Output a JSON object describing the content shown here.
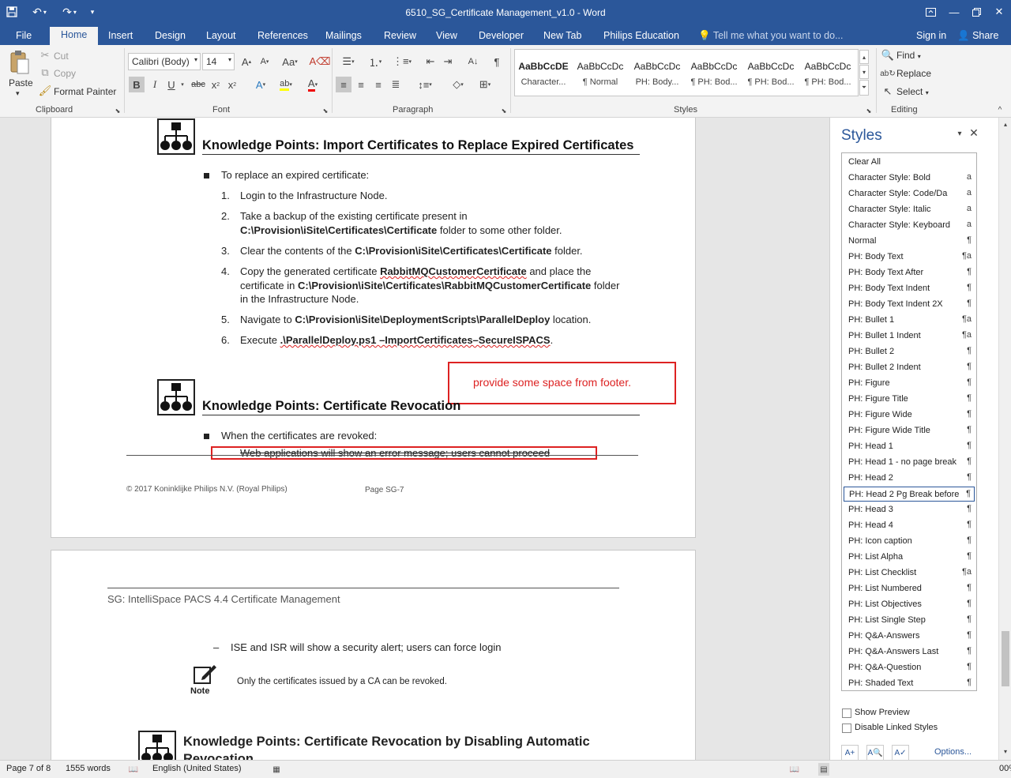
{
  "window": {
    "title": "6510_SG_Certificate Management_v1.0 - Word"
  },
  "quick_access": {
    "save_icon": "save-icon",
    "undo_icon": "undo-icon",
    "redo_icon": "redo-icon"
  },
  "tabs": [
    "File",
    "Home",
    "Insert",
    "Design",
    "Layout",
    "References",
    "Mailings",
    "Review",
    "View",
    "Developer",
    "New Tab",
    "Philips Education"
  ],
  "tell_me": "Tell me what you want to do...",
  "account": {
    "signin": "Sign in",
    "share": "Share"
  },
  "clipboard": {
    "paste": "Paste",
    "cut": "Cut",
    "copy": "Copy",
    "format_painter": "Format Painter",
    "label": "Clipboard"
  },
  "font": {
    "name": "Calibri (Body)",
    "size": "14",
    "label": "Font"
  },
  "paragraph": {
    "label": "Paragraph"
  },
  "styles_group": {
    "label": "Styles",
    "items": [
      {
        "sample": "AaBbCcDE",
        "name": "Character..."
      },
      {
        "sample": "AaBbCcDc",
        "name": "¶ Normal"
      },
      {
        "sample": "AaBbCcDc",
        "name": "PH: Body..."
      },
      {
        "sample": "AaBbCcDc",
        "name": "¶ PH: Bod..."
      },
      {
        "sample": "AaBbCcDc",
        "name": "¶ PH: Bod..."
      },
      {
        "sample": "AaBbCcDc",
        "name": "¶ PH: Bod..."
      }
    ]
  },
  "editing": {
    "find": "Find",
    "replace": "Replace",
    "select": "Select",
    "label": "Editing"
  },
  "doc": {
    "kp1_title": "Knowledge Points: Import Certificates to Replace Expired Certificates",
    "kp1_intro": "To replace an expired certificate:",
    "steps": [
      {
        "n": "1.",
        "l1a": "Login to the Infrastructure Node."
      },
      {
        "n": "2.",
        "l1a": "Take a backup of the existing certificate present in",
        "l2b": "C:\\Provision\\iSite\\Certificates\\Certificate",
        "l2a": " folder to some other folder."
      },
      {
        "n": "3.",
        "l1a": "Clear the contents of the ",
        "l1b": "C:\\Provision\\iSite\\Certificates\\Certificate",
        "l1c": " folder."
      },
      {
        "n": "4.",
        "l1a": "Copy the generated certificate ",
        "l1b": "RabbitMQCustomerCertificate",
        "l1c": " and place the",
        "l2a": "certificate in ",
        "l2b": "C:\\Provision\\iSite\\Certificates\\RabbitMQCustomerCertificate",
        "l2c": " folder",
        "l3a": "in the Infrastructure Node."
      },
      {
        "n": "5.",
        "l1a": "Navigate to ",
        "l1b": "C:\\Provision\\iSite\\DeploymentScripts\\ParallelDeploy",
        "l1c": " location."
      },
      {
        "n": "6.",
        "l1a": "Execute ",
        "l1b": ".\\ParallelDeploy.ps1 –ImportCertificates–SecureISPACS",
        "l1c": "."
      }
    ],
    "annotation": "provide some space from footer.",
    "kp2_title": "Knowledge Points: Certificate Revocation",
    "kp2_intro": "When the certificates are revoked:",
    "kp2_sub": "Web applications will show an error message; users cannot proceed",
    "footer_left": "© 2017 Koninklijke Philips N.V. (Royal Philips)",
    "footer_page": "Page SG-7",
    "header2": "SG: IntelliSpace PACS 4.4 Certificate Management",
    "dash_item": "ISE and ISR will show a security alert; users can force login",
    "note_label": "Note",
    "note_text": "Only the certificates issued by a CA can be revoked.",
    "kp3_title_l1": "Knowledge Points: Certificate Revocation by Disabling Automatic",
    "kp3_title_l2": "Revocation"
  },
  "styles_pane": {
    "title": "Styles",
    "items": [
      {
        "name": "Clear All",
        "mark": ""
      },
      {
        "name": "Character Style: Bold",
        "mark": "a"
      },
      {
        "name": "Character Style: Code/Da",
        "mark": "a"
      },
      {
        "name": "Character Style: Italic",
        "mark": "a"
      },
      {
        "name": "Character Style: Keyboard",
        "mark": "a"
      },
      {
        "name": "Normal",
        "mark": "¶"
      },
      {
        "name": "PH: Body Text",
        "mark": "¶a"
      },
      {
        "name": "PH: Body Text After",
        "mark": "¶"
      },
      {
        "name": "PH: Body Text Indent",
        "mark": "¶"
      },
      {
        "name": "PH: Body Text Indent 2X",
        "mark": "¶"
      },
      {
        "name": "PH: Bullet 1",
        "mark": "¶a"
      },
      {
        "name": "PH: Bullet 1 Indent",
        "mark": "¶a"
      },
      {
        "name": "PH: Bullet 2",
        "mark": "¶"
      },
      {
        "name": "PH: Bullet 2 Indent",
        "mark": "¶"
      },
      {
        "name": "PH: Figure",
        "mark": "¶"
      },
      {
        "name": "PH: Figure Title",
        "mark": "¶"
      },
      {
        "name": "PH: Figure Wide",
        "mark": "¶"
      },
      {
        "name": "PH: Figure Wide Title",
        "mark": "¶"
      },
      {
        "name": "PH: Head 1",
        "mark": "¶"
      },
      {
        "name": "PH: Head 1 - no page break",
        "mark": "¶"
      },
      {
        "name": "PH: Head 2",
        "mark": "¶"
      },
      {
        "name": "PH: Head 2 Pg Break before",
        "mark": "¶"
      },
      {
        "name": "PH: Head 3",
        "mark": "¶"
      },
      {
        "name": "PH: Head 4",
        "mark": "¶"
      },
      {
        "name": "PH: Icon caption",
        "mark": "¶"
      },
      {
        "name": "PH: List Alpha",
        "mark": "¶"
      },
      {
        "name": "PH: List Checklist",
        "mark": "¶a"
      },
      {
        "name": "PH: List Numbered",
        "mark": "¶"
      },
      {
        "name": "PH: List Objectives",
        "mark": "¶"
      },
      {
        "name": "PH: List Single Step",
        "mark": "¶"
      },
      {
        "name": "PH: Q&A-Answers",
        "mark": "¶"
      },
      {
        "name": "PH: Q&A-Answers Last",
        "mark": "¶"
      },
      {
        "name": "PH: Q&A-Question",
        "mark": "¶"
      },
      {
        "name": "PH: Shaded Text",
        "mark": "¶"
      }
    ],
    "selected_index": 21,
    "show_preview": "Show Preview",
    "disable_linked": "Disable Linked Styles",
    "options": "Options..."
  },
  "status": {
    "page": "Page 7 of 8",
    "words": "1555 words",
    "language": "English (United States)",
    "zoom": "00%"
  }
}
